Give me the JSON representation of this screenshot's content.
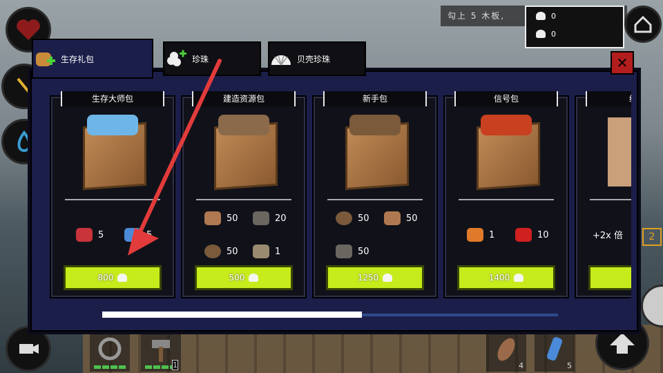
{
  "hud": {
    "quest_text": "勾上 5 木板,",
    "currency": [
      {
        "icon": "shell-icon",
        "value": "0"
      },
      {
        "icon": "pearl-icon",
        "value": "0"
      }
    ],
    "badge": "2"
  },
  "tabs": [
    {
      "label": "生存礼包",
      "icon": "backpack-plus-icon",
      "active": true
    },
    {
      "label": "珍珠",
      "icon": "pearls-plus-icon",
      "active": false
    },
    {
      "label": "贝壳珍珠",
      "icon": "shell-icon",
      "active": false
    }
  ],
  "cards": [
    {
      "title": "生存大师包",
      "items": [
        {
          "icon": "can-food-icon",
          "qty": "5"
        },
        {
          "icon": "water-bottle-icon",
          "qty": "5"
        }
      ],
      "price": "800"
    },
    {
      "title": "建造资源包",
      "items": [
        {
          "icon": "plank-icon",
          "qty": "50"
        },
        {
          "icon": "scrap-icon",
          "qty": "20"
        },
        {
          "icon": "rope-icon",
          "qty": "50"
        },
        {
          "icon": "hammer-icon",
          "qty": "1"
        }
      ],
      "price": "500"
    },
    {
      "title": "新手包",
      "items": [
        {
          "icon": "rope-icon",
          "qty": "50"
        },
        {
          "icon": "plank-icon",
          "qty": "50"
        },
        {
          "icon": "scrap-icon",
          "qty": "50"
        }
      ],
      "price": "1250"
    },
    {
      "title": "信号包",
      "items": [
        {
          "icon": "flare-gun-icon",
          "qty": "1"
        },
        {
          "icon": "flare-icon",
          "qty": "10"
        }
      ],
      "price": "1400"
    },
    {
      "title": "经验",
      "items": [
        {
          "icon": "",
          "qty": "+2x 倍"
        }
      ],
      "price": ""
    }
  ],
  "hotbar": [
    {
      "icon": "rope-hook-icon",
      "count": ""
    },
    {
      "icon": "hammer-icon",
      "count": "1"
    },
    {
      "icon": "fish-icon",
      "count": "4"
    },
    {
      "icon": "water-bottle-icon",
      "count": "5"
    }
  ],
  "scroll": {
    "position": 0.57
  },
  "colors": {
    "accent_buy": "#c6ec1c",
    "panel": "#1c1e4a",
    "arrow": "#e23b3b"
  }
}
